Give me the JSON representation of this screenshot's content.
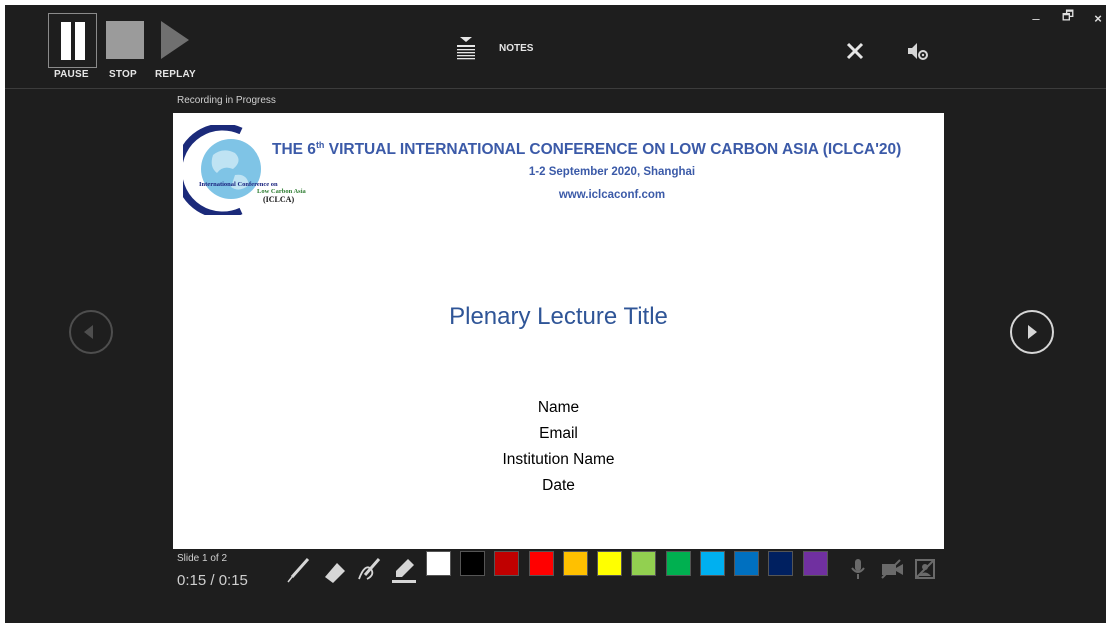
{
  "window_controls": {
    "minimize": "–",
    "restore": "🗗",
    "close": "×"
  },
  "toolbar": {
    "pause_label": "PAUSE",
    "stop_label": "STOP",
    "replay_label": "REPLAY",
    "notes_label": "NOTES",
    "icons": [
      "pause-icon",
      "stop-icon",
      "replay-icon",
      "notes-icon",
      "close-icon",
      "audio-settings-icon"
    ]
  },
  "status": {
    "recording": "Recording in Progress"
  },
  "slide": {
    "logo": {
      "line1": "International Conference on",
      "line2": "Low Carbon Asia",
      "line3": "(ICLCA)"
    },
    "conference_title_pre": "THE 6",
    "conference_title_sup": "th",
    "conference_title_post": " VIRTUAL INTERNATIONAL CONFERENCE ON LOW CARBON ASIA (ICLCA'20)",
    "conference_date": "1-2 September 2020, Shanghai",
    "conference_url": "www.iclcaconf.com",
    "lecture_title": "Plenary Lecture Title",
    "info_lines": [
      "Name",
      "Email",
      "Institution Name",
      "Date"
    ]
  },
  "footer": {
    "slide_count": "Slide 1 of 2",
    "timer": "0:15 / 0:15",
    "tools": [
      "pen-icon",
      "eraser-icon",
      "pen-style-icon",
      "highlighter-icon"
    ],
    "colors": [
      "#ffffff",
      "#000000",
      "#c00000",
      "#ff0000",
      "#ffc000",
      "#ffff00",
      "#92d050",
      "#00b050",
      "#00b0f0",
      "#0070c0",
      "#002060",
      "#7030a0"
    ],
    "media": [
      "microphone-icon",
      "camera-off-icon",
      "camera-preview-off-icon"
    ]
  },
  "colors": {
    "background": "#1e1e1e",
    "slide_accent": "#3b5aa8",
    "lecture_title": "#2f5597"
  }
}
